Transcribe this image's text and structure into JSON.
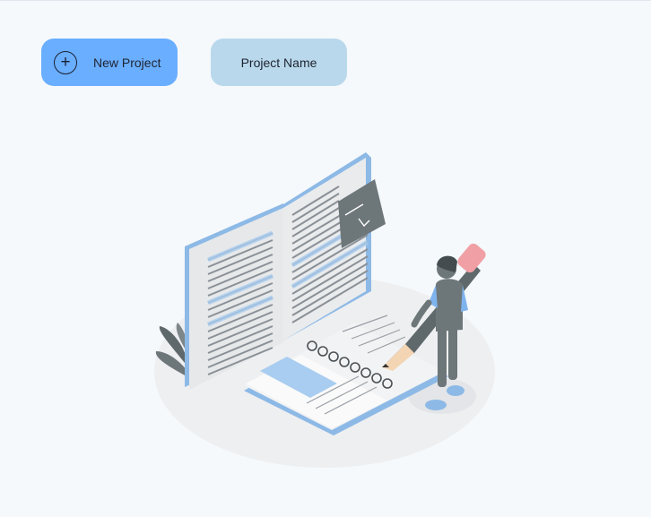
{
  "toolbar": {
    "new_project_label": "New Project",
    "new_project_icon": "plus-circle-icon",
    "project_name_label": "Project Name"
  },
  "illustration": {
    "name": "book-writing-illustration",
    "colors": {
      "accent": "#6aaeff",
      "pale": "#b9d8ec",
      "figure": "#6d7679",
      "eraser": "#f0a0a4",
      "shadow": "#eeeff1"
    }
  }
}
